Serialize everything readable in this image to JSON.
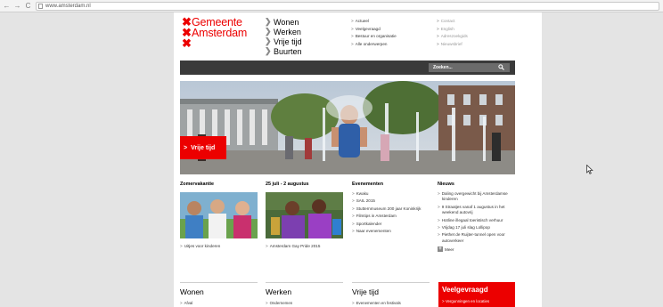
{
  "browser": {
    "back_glyph": "←",
    "forward_glyph": "→",
    "reload_glyph": "C",
    "url": "www.amsterdam.nl"
  },
  "logo": {
    "line1": "Gemeente",
    "line2": "Amsterdam",
    "x_mark": "✖"
  },
  "main_nav": {
    "chevron": "❯",
    "items": [
      "Wonen",
      "Werken",
      "Vrije tijd",
      "Buurten"
    ]
  },
  "sub_nav_left": {
    "arrow": ">",
    "items": [
      "Actueel",
      "Veelgevraagd",
      "Bestuur en organisatie",
      "Alle onderwerpen"
    ]
  },
  "sub_nav_right": {
    "arrow": ">",
    "items": [
      "Contact",
      "English",
      "Adreszoekgids",
      "Nieuwsbrief"
    ]
  },
  "search": {
    "placeholder": "Zoeken..."
  },
  "hero": {
    "tag_label": "Vrije tijd",
    "tag_arrow": ">"
  },
  "columns": {
    "arrow": ">",
    "zomervakantie": {
      "title": "Zomervakantie",
      "link": "Uitjes voor kinderen"
    },
    "gaypride": {
      "title": "25 juli - 2 augustus",
      "link": "Amsterdam Gay Pride 2015"
    },
    "evenementen": {
      "title": "Evenementen",
      "items": [
        "Kwaku",
        "SAIL 2015",
        "Stutternmuseum 200 jaar Koninkrijk",
        "Filmtips in Amsterdam",
        "Sportkalender",
        "Naar evenementen"
      ]
    },
    "nieuws": {
      "title": "Nieuws",
      "items": [
        "Daling overgewicht bij Amsterdamse kinderen",
        "9 Straatjes vanaf 1 augustus in het weekend autovrij",
        "Hotline illegaal toeristisch verhuur",
        "Vrijdag 17 juli slag Lollipop",
        "Piethet de Ruijter-tunnel open voor autoverkeer"
      ],
      "more": "Meer"
    }
  },
  "bottom": {
    "arrow": ">",
    "wonen": {
      "title": "Wonen",
      "link": "Afval"
    },
    "werken": {
      "title": "Werken",
      "link": "Ondernemen"
    },
    "vrije_tijd": {
      "title": "Vrije tijd",
      "link": "Evenementen en festivals"
    },
    "veelgevraagd": {
      "title": "Veelgevraagd",
      "link": "Vergunningen en locaties"
    }
  },
  "colors": {
    "brand_red": "#ec0000",
    "search_bar": "#3a3a3a",
    "background": "#e4e4e4"
  }
}
